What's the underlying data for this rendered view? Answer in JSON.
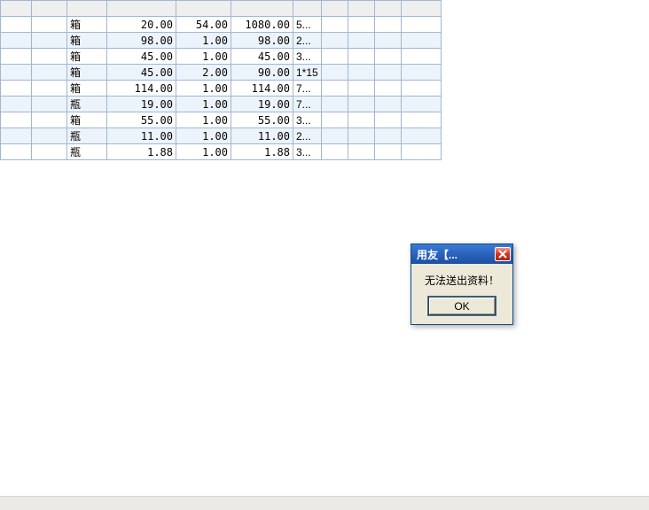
{
  "table": {
    "headers": [
      "",
      "",
      "",
      "",
      "",
      "",
      "",
      "",
      "",
      "",
      ""
    ],
    "rows": [
      {
        "unit": "箱",
        "price": "20.00",
        "qty": "54.00",
        "amount": "1080.00",
        "note": "5..."
      },
      {
        "unit": "箱",
        "price": "98.00",
        "qty": "1.00",
        "amount": "98.00",
        "note": "2..."
      },
      {
        "unit": "箱",
        "price": "45.00",
        "qty": "1.00",
        "amount": "45.00",
        "note": "3..."
      },
      {
        "unit": "箱",
        "price": "45.00",
        "qty": "2.00",
        "amount": "90.00",
        "note": "1*15"
      },
      {
        "unit": "箱",
        "price": "114.00",
        "qty": "1.00",
        "amount": "114.00",
        "note": "7..."
      },
      {
        "unit": "瓶",
        "price": "19.00",
        "qty": "1.00",
        "amount": "19.00",
        "note": "7..."
      },
      {
        "unit": "箱",
        "price": "55.00",
        "qty": "1.00",
        "amount": "55.00",
        "note": "3..."
      },
      {
        "unit": "瓶",
        "price": "11.00",
        "qty": "1.00",
        "amount": "11.00",
        "note": "2..."
      },
      {
        "unit": "瓶",
        "price": "1.88",
        "qty": "1.00",
        "amount": "1.88",
        "note": "3..."
      }
    ]
  },
  "dialog": {
    "title": "用友【...",
    "message": "无法送出资料！",
    "ok_label": "OK"
  }
}
